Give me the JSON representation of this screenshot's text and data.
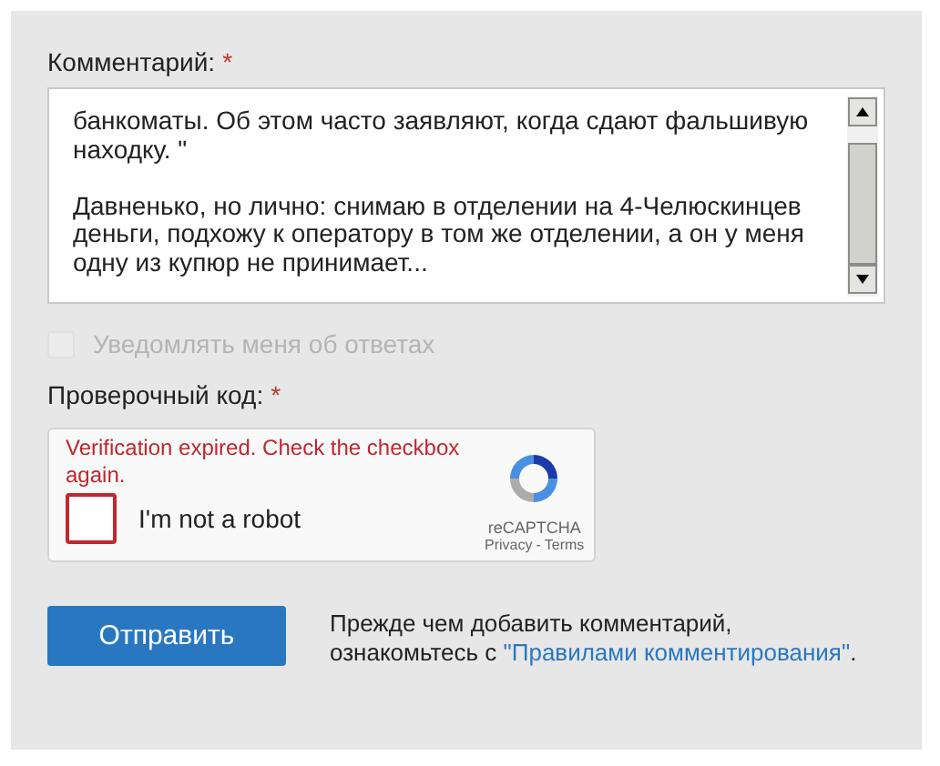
{
  "comment": {
    "label": "Комментарий:",
    "required_mark": "*",
    "paragraphs": [
      "банкоматы. Об этом часто заявляют, когда сдают фальшивую находку. \"",
      "Давненько, но лично: снимаю в отделении на 4-Челюскинцев деньги, подхожу к оператору в том же отделении, а он у меня одну из купюр не принимает..."
    ]
  },
  "notify": {
    "label": "Уведомлять меня об ответах",
    "checked": false,
    "disabled": true
  },
  "captcha": {
    "label": "Проверочный код:",
    "required_mark": "*",
    "error": "Verification expired. Check the checkbox again.",
    "checkbox_label": "I'm not a robot",
    "checked": false,
    "brand": "reCAPTCHA",
    "privacy": "Privacy",
    "separator": "-",
    "terms": "Terms"
  },
  "submit": {
    "label": "Отправить"
  },
  "rules": {
    "before": "Прежде чем добавить комментарий,\nознакомьтесь с ",
    "link": "\"Правилами комментирования\"",
    "after": "."
  }
}
